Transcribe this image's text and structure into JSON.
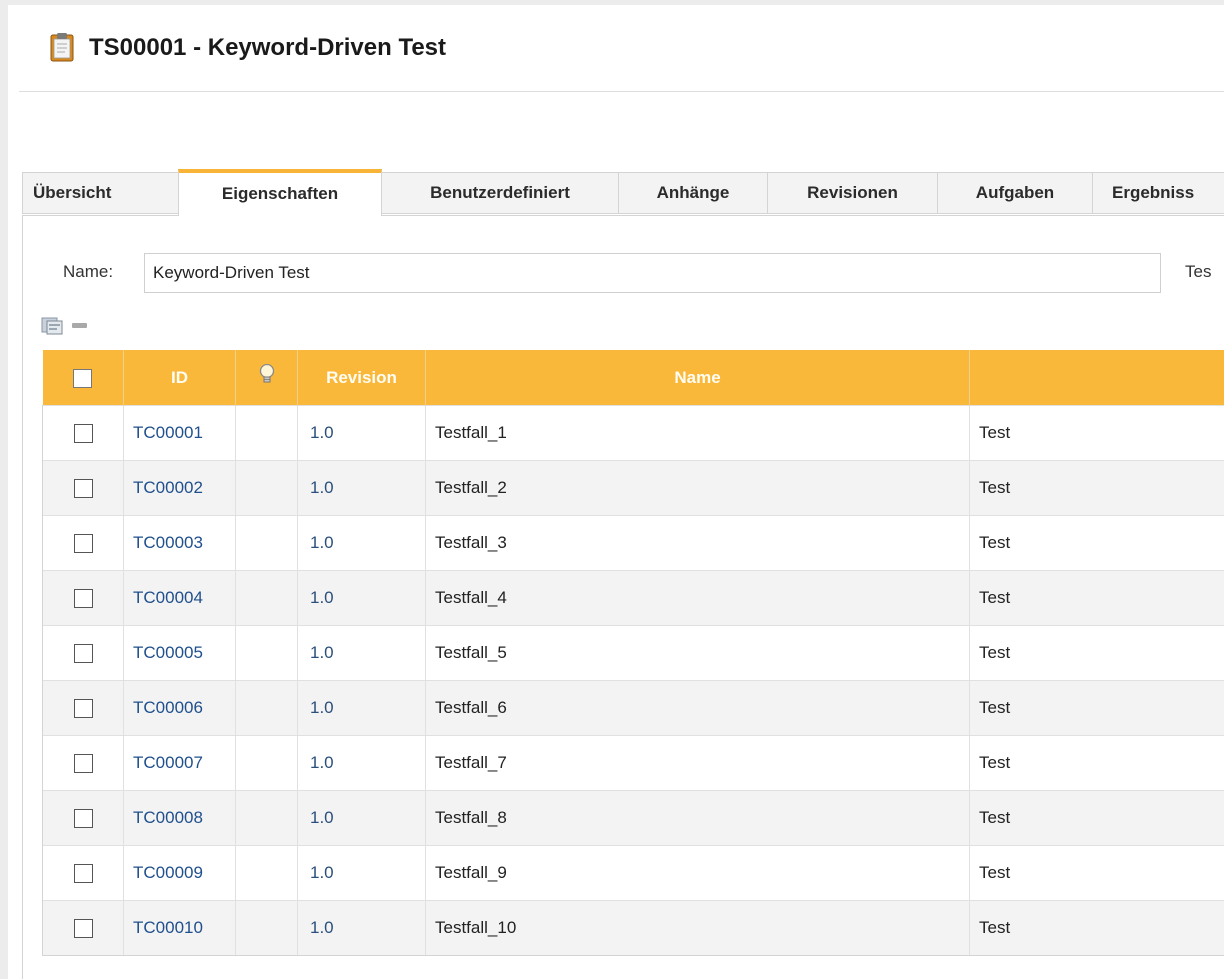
{
  "header": {
    "title": "TS00001 - Keyword-Driven Test",
    "accent": "#f7b436"
  },
  "tabs": [
    {
      "label": "Übersicht"
    },
    {
      "label": "Eigenschaften",
      "active": true
    },
    {
      "label": "Benutzerdefiniert"
    },
    {
      "label": "Anhänge"
    },
    {
      "label": "Revisionen"
    },
    {
      "label": "Aufgaben"
    },
    {
      "label": "Ergebniss"
    }
  ],
  "form": {
    "name_label": "Name:",
    "name_value": "Keyword-Driven Test",
    "side_label": "Tes"
  },
  "toolbar": {
    "add_icon": "add-testcase-icon",
    "remove_icon": "remove-minus-icon"
  },
  "table": {
    "header_color": "#f9b839",
    "columns": {
      "id": "ID",
      "hint_icon": "lightbulb-icon",
      "revision": "Revision",
      "name": "Name",
      "extra": ""
    },
    "rows": [
      {
        "id": "TC00001",
        "revision": "1.0",
        "name": "Testfall_1",
        "extra": "Test"
      },
      {
        "id": "TC00002",
        "revision": "1.0",
        "name": "Testfall_2",
        "extra": "Test"
      },
      {
        "id": "TC00003",
        "revision": "1.0",
        "name": "Testfall_3",
        "extra": "Test"
      },
      {
        "id": "TC00004",
        "revision": "1.0",
        "name": "Testfall_4",
        "extra": "Test"
      },
      {
        "id": "TC00005",
        "revision": "1.0",
        "name": "Testfall_5",
        "extra": "Test"
      },
      {
        "id": "TC00006",
        "revision": "1.0",
        "name": "Testfall_6",
        "extra": "Test"
      },
      {
        "id": "TC00007",
        "revision": "1.0",
        "name": "Testfall_7",
        "extra": "Test"
      },
      {
        "id": "TC00008",
        "revision": "1.0",
        "name": "Testfall_8",
        "extra": "Test"
      },
      {
        "id": "TC00009",
        "revision": "1.0",
        "name": "Testfall_9",
        "extra": "Test"
      },
      {
        "id": "TC00010",
        "revision": "1.0",
        "name": "Testfall_10",
        "extra": "Test"
      }
    ]
  }
}
